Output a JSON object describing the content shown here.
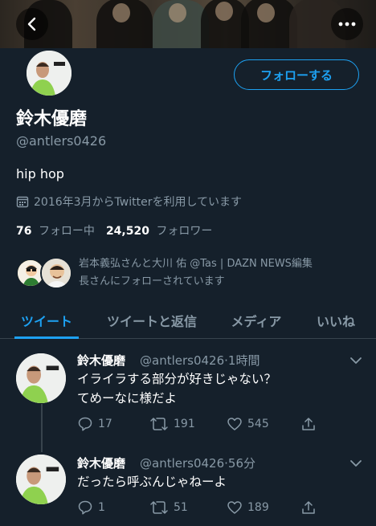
{
  "header": {
    "back_icon": "chevron-left-icon",
    "more_icon": "ellipsis-icon"
  },
  "profile": {
    "display_name": "鈴木優磨",
    "handle": "@antlers0426",
    "bio": "hip hop",
    "joined": "2016年3月からTwitterを利用しています",
    "following_count": "76",
    "following_label": "フォロー中",
    "followers_count": "24,520",
    "followers_label": "フォロワー",
    "follow_button": "フォローする",
    "followed_by_line1": "岩本義弘さんと大川 佑 @Tas | DAZN NEWS編集",
    "followed_by_line2": "長さんにフォローされています"
  },
  "tabs": [
    {
      "label": "ツイート",
      "active": true
    },
    {
      "label": "ツイートと返信",
      "active": false
    },
    {
      "label": "メディア",
      "active": false
    },
    {
      "label": "いいね",
      "active": false
    }
  ],
  "tweets": [
    {
      "name": "鈴木優磨",
      "handle": "@antlers0426",
      "time": "1時間",
      "lines": [
        "イライラする部分が好きじゃない？",
        "てめーなに様だよ"
      ],
      "replies": "17",
      "retweets": "191",
      "likes": "545"
    },
    {
      "name": "鈴木優磨",
      "handle": "@antlers0426",
      "time": "56分",
      "lines": [
        "だったら呼ぶんじゃねーよ"
      ],
      "replies": "1",
      "retweets": "51",
      "likes": "189"
    }
  ],
  "colors": {
    "background": "#15202b",
    "accent": "#1da1f2",
    "secondary_text": "#8899a6",
    "divider": "#38444d"
  }
}
